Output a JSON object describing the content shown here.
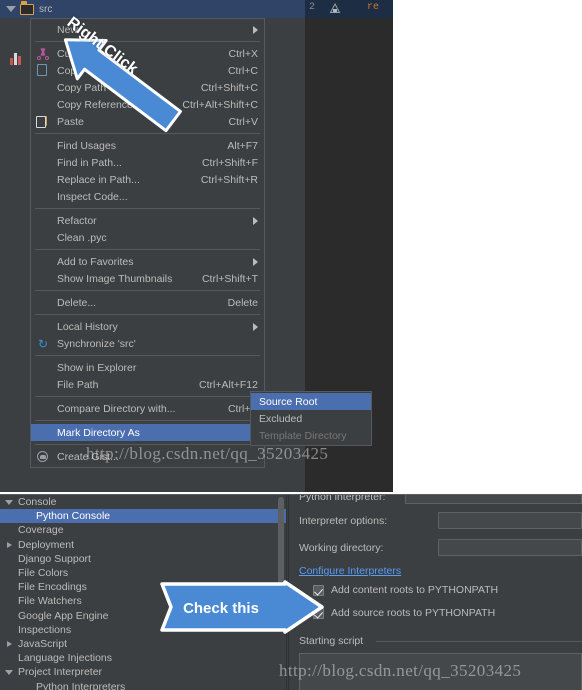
{
  "top_screenshot": {
    "project_tree": {
      "selected_node": "src",
      "node_icon": "folder-icon",
      "expand_icon": "triangle-down-icon",
      "tool_icon": "bar-chart-icon"
    },
    "editor": {
      "line_number": "2",
      "gutter_icon": "run-configuration-icon",
      "code_fragment": "re"
    },
    "context_menu": {
      "items": [
        {
          "label": "New",
          "accel": "",
          "icon": "",
          "submenu": true,
          "separator_after": true
        },
        {
          "label": "Cut",
          "accel": "Ctrl+X",
          "icon": "cut-icon",
          "submenu": false,
          "separator_after": false
        },
        {
          "label": "Copy",
          "accel": "Ctrl+C",
          "icon": "copy-icon",
          "submenu": false,
          "separator_after": false
        },
        {
          "label": "Copy Path",
          "accel": "Ctrl+Shift+C",
          "icon": "",
          "submenu": false,
          "separator_after": false
        },
        {
          "label": "Copy Reference",
          "accel": "Ctrl+Alt+Shift+C",
          "icon": "",
          "submenu": false,
          "separator_after": false
        },
        {
          "label": "Paste",
          "accel": "Ctrl+V",
          "icon": "paste-icon",
          "submenu": false,
          "separator_after": true
        },
        {
          "label": "Find Usages",
          "accel": "Alt+F7",
          "icon": "",
          "submenu": false,
          "separator_after": false
        },
        {
          "label": "Find in Path...",
          "accel": "Ctrl+Shift+F",
          "icon": "",
          "submenu": false,
          "separator_after": false
        },
        {
          "label": "Replace in Path...",
          "accel": "Ctrl+Shift+R",
          "icon": "",
          "submenu": false,
          "separator_after": false
        },
        {
          "label": "Inspect Code...",
          "accel": "",
          "icon": "",
          "submenu": false,
          "separator_after": true
        },
        {
          "label": "Refactor",
          "accel": "",
          "icon": "",
          "submenu": true,
          "separator_after": false
        },
        {
          "label": "Clean .pyc",
          "accel": "",
          "icon": "",
          "submenu": false,
          "separator_after": true
        },
        {
          "label": "Add to Favorites",
          "accel": "",
          "icon": "",
          "submenu": true,
          "separator_after": false
        },
        {
          "label": "Show Image Thumbnails",
          "accel": "Ctrl+Shift+T",
          "icon": "",
          "submenu": false,
          "separator_after": true
        },
        {
          "label": "Delete...",
          "accel": "Delete",
          "icon": "",
          "submenu": false,
          "separator_after": true
        },
        {
          "label": "Local History",
          "accel": "",
          "icon": "",
          "submenu": true,
          "separator_after": false
        },
        {
          "label": "Synchronize 'src'",
          "accel": "",
          "icon": "sync-icon",
          "submenu": false,
          "separator_after": true
        },
        {
          "label": "Show in Explorer",
          "accel": "",
          "icon": "",
          "submenu": false,
          "separator_after": false
        },
        {
          "label": "File Path",
          "accel": "Ctrl+Alt+F12",
          "icon": "",
          "submenu": false,
          "separator_after": true
        },
        {
          "label": "Compare Directory with...",
          "accel": "Ctrl+D",
          "icon": "",
          "submenu": false,
          "separator_after": true
        },
        {
          "label": "Mark Directory As",
          "accel": "",
          "icon": "",
          "submenu": true,
          "separator_after": true,
          "highlighted": true
        },
        {
          "label": "Create Gist...",
          "accel": "",
          "icon": "gist-icon",
          "submenu": false,
          "separator_after": false
        }
      ]
    },
    "submenu": {
      "items": [
        {
          "label": "Source Root",
          "highlighted": true,
          "disabled": false
        },
        {
          "label": "Excluded",
          "highlighted": false,
          "disabled": false
        },
        {
          "label": "Template Directory",
          "highlighted": false,
          "disabled": true
        }
      ]
    },
    "annotation_arrow": {
      "text": "Right Click",
      "fill_color": "#4a8ad4",
      "stroke_color": "#ffffff",
      "direction": "up-left"
    },
    "watermark": "http://blog.csdn.net/qq_35203425"
  },
  "bottom_screenshot": {
    "settings_tree": {
      "items": [
        {
          "label": "Console",
          "expander": "down",
          "indent": 0,
          "selected": false
        },
        {
          "label": "Python Console",
          "expander": "none",
          "indent": 1,
          "selected": true
        },
        {
          "label": "Coverage",
          "expander": "none",
          "indent": 0,
          "selected": false
        },
        {
          "label": "Deployment",
          "expander": "right",
          "indent": 0,
          "selected": false
        },
        {
          "label": "Django Support",
          "expander": "none",
          "indent": 0,
          "selected": false
        },
        {
          "label": "File Colors",
          "expander": "none",
          "indent": 0,
          "selected": false
        },
        {
          "label": "File Encodings",
          "expander": "none",
          "indent": 0,
          "selected": false
        },
        {
          "label": "File Watchers",
          "expander": "none",
          "indent": 0,
          "selected": false
        },
        {
          "label": "Google App Engine",
          "expander": "none",
          "indent": 0,
          "selected": false
        },
        {
          "label": "Inspections",
          "expander": "none",
          "indent": 0,
          "selected": false
        },
        {
          "label": "JavaScript",
          "expander": "right",
          "indent": 0,
          "selected": false
        },
        {
          "label": "Language Injections",
          "expander": "none",
          "indent": 0,
          "selected": false
        },
        {
          "label": "Project Interpreter",
          "expander": "down",
          "indent": 0,
          "selected": false
        },
        {
          "label": "Python Interpreters",
          "expander": "none",
          "indent": 1,
          "selected": false
        }
      ]
    },
    "detail_panel": {
      "cut_off_row_label": "Python interpreter:",
      "fields": [
        {
          "label": "Interpreter options:",
          "value": ""
        },
        {
          "label": "Working directory:",
          "value": ""
        }
      ],
      "link": "Configure Interpreters",
      "checkboxes": [
        {
          "label": "Add content roots to PYTHONPATH",
          "checked": true
        },
        {
          "label": "Add source roots to PYTHONPATH",
          "checked": true
        }
      ],
      "group_title": "Starting script"
    },
    "annotation_arrow": {
      "text": "Check this",
      "fill_color": "#4a8ad4",
      "stroke_color": "#ffffff",
      "direction": "right"
    },
    "watermark": "http://blog.csdn.net/qq_35203425"
  }
}
